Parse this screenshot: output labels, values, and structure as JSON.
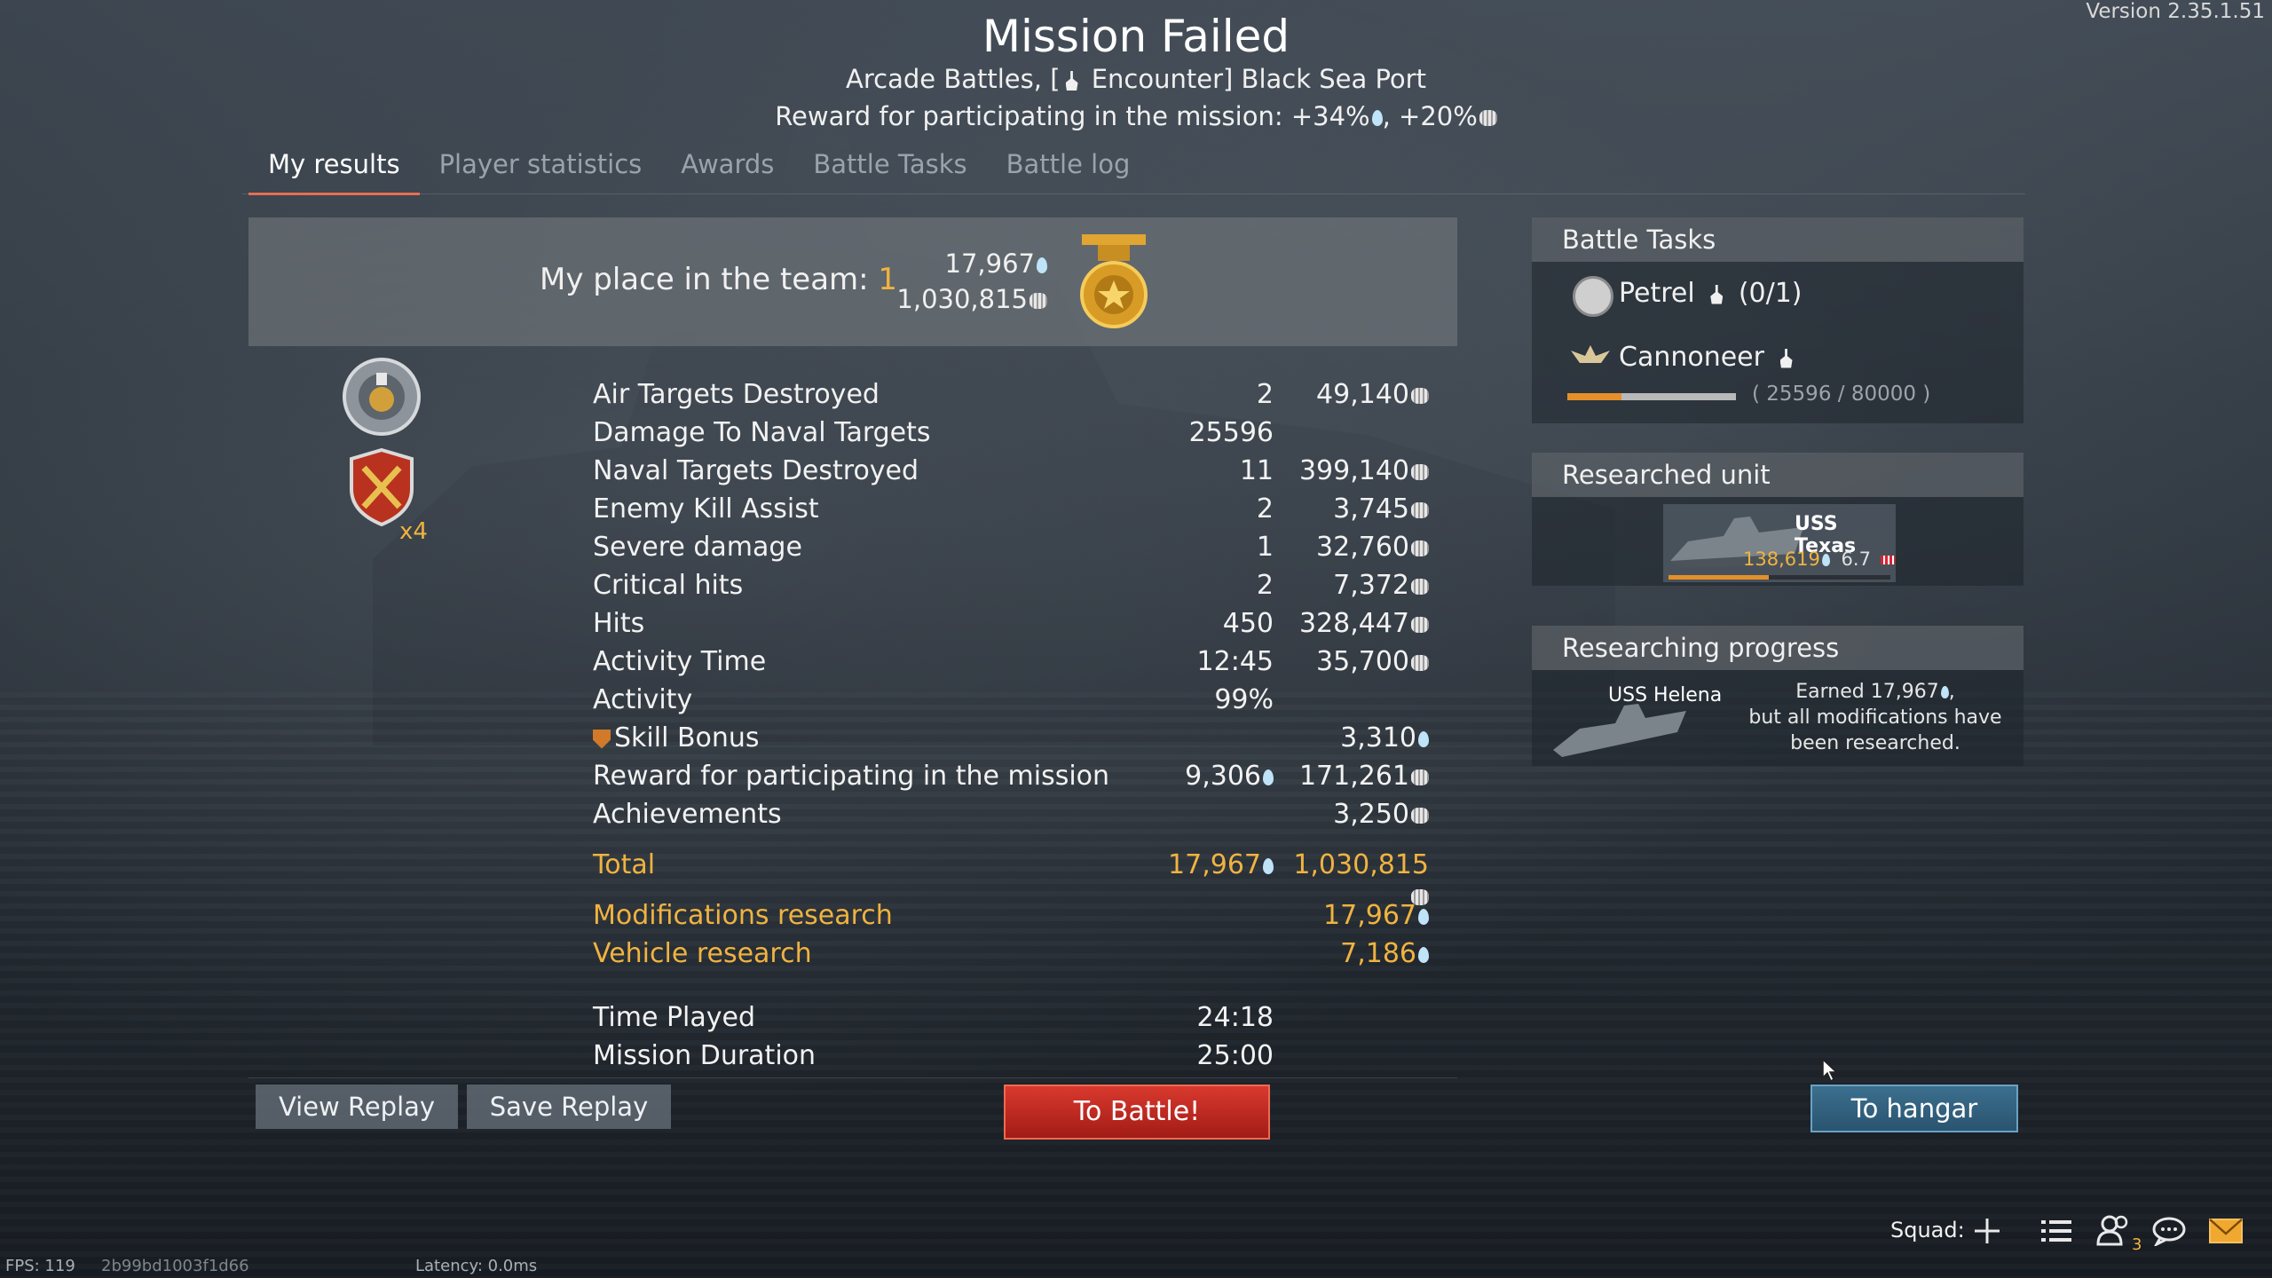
{
  "version": "Version 2.35.1.51",
  "header": {
    "title": "Mission Failed",
    "subtitle_prefix": "Arcade Battles, [",
    "subtitle_suffix": " Encounter] Black Sea Port",
    "reward_text": "Reward for participating in the mission: +34%",
    "reward_text_2": ", +20%"
  },
  "tabs": [
    "My results",
    "Player statistics",
    "Awards",
    "Battle Tasks",
    "Battle log"
  ],
  "place": {
    "label": "My place in the team: ",
    "value": "1",
    "rp": "17,967",
    "sl": "1,030,815"
  },
  "awards": {
    "multiplier": "x4"
  },
  "results": [
    {
      "label": "Air Targets Destroyed",
      "count": "2",
      "reward": "49,140",
      "icon": "silver-lions"
    },
    {
      "label": "Damage To Naval Targets",
      "count": "25596",
      "reward": "",
      "icon": ""
    },
    {
      "label": "Naval Targets Destroyed",
      "count": "11",
      "reward": "399,140",
      "icon": "silver-lions"
    },
    {
      "label": "Enemy Kill Assist",
      "count": "2",
      "reward": "3,745",
      "icon": "silver-lions"
    },
    {
      "label": "Severe damage",
      "count": "1",
      "reward": "32,760",
      "icon": "silver-lions"
    },
    {
      "label": "Critical hits",
      "count": "2",
      "reward": "7,372",
      "icon": "silver-lions"
    },
    {
      "label": "Hits",
      "count": "450",
      "reward": "328,447",
      "icon": "silver-lions"
    },
    {
      "label": "Activity Time",
      "count": "12:45",
      "reward": "35,700",
      "icon": "silver-lions"
    },
    {
      "label": "Activity",
      "count": "99%",
      "reward": "",
      "icon": ""
    },
    {
      "label": "Skill Bonus",
      "count": "",
      "reward": "3,310",
      "icon": "research-points"
    },
    {
      "label": "Reward for participating in the mission",
      "count": "9,306",
      "reward": "171,261",
      "icon": "silver-lions"
    },
    {
      "label": "Achievements",
      "count": "",
      "reward": "3,250",
      "icon": "silver-lions"
    }
  ],
  "total": {
    "label": "Total",
    "rp": "17,967",
    "sl": "1,030,815"
  },
  "research": [
    {
      "label": "Modifications research",
      "value": "17,967"
    },
    {
      "label": "Vehicle research",
      "value": "7,186"
    }
  ],
  "time": [
    {
      "label": "Time Played",
      "value": "24:18"
    },
    {
      "label": "Mission Duration",
      "value": "25:00"
    }
  ],
  "battle_tasks": {
    "title": "Battle Tasks",
    "task1": "Petrel",
    "task1_progress": "(0/1)",
    "task2": "Cannoneer",
    "task2_progress": "( 25596 / 80000 )",
    "task2_fraction": 0.32
  },
  "researched_unit": {
    "title": "Researched unit",
    "name": "USS Texas",
    "rp": "138,619",
    "br": "6.7",
    "progress": 0.45
  },
  "researching": {
    "title": "Researching progress",
    "name": "USS Helena",
    "earned": "Earned 17,967",
    "note": "but all modifications have been researched."
  },
  "buttons": {
    "view_replay": "View Replay",
    "save_replay": "Save Replay",
    "to_battle": "To Battle!",
    "to_hangar": "To hangar"
  },
  "bottom": {
    "squad": "Squad:",
    "friends_count": "3",
    "fps": "FPS: 119",
    "hash": "2b99bd1003f1d66",
    "latency": "Latency:  0.0ms"
  },
  "colors": {
    "accent": "#f0b340",
    "tab_underline": "#e2684a",
    "battle_button": "#c42a20",
    "hangar_button": "#2f5e7c"
  }
}
